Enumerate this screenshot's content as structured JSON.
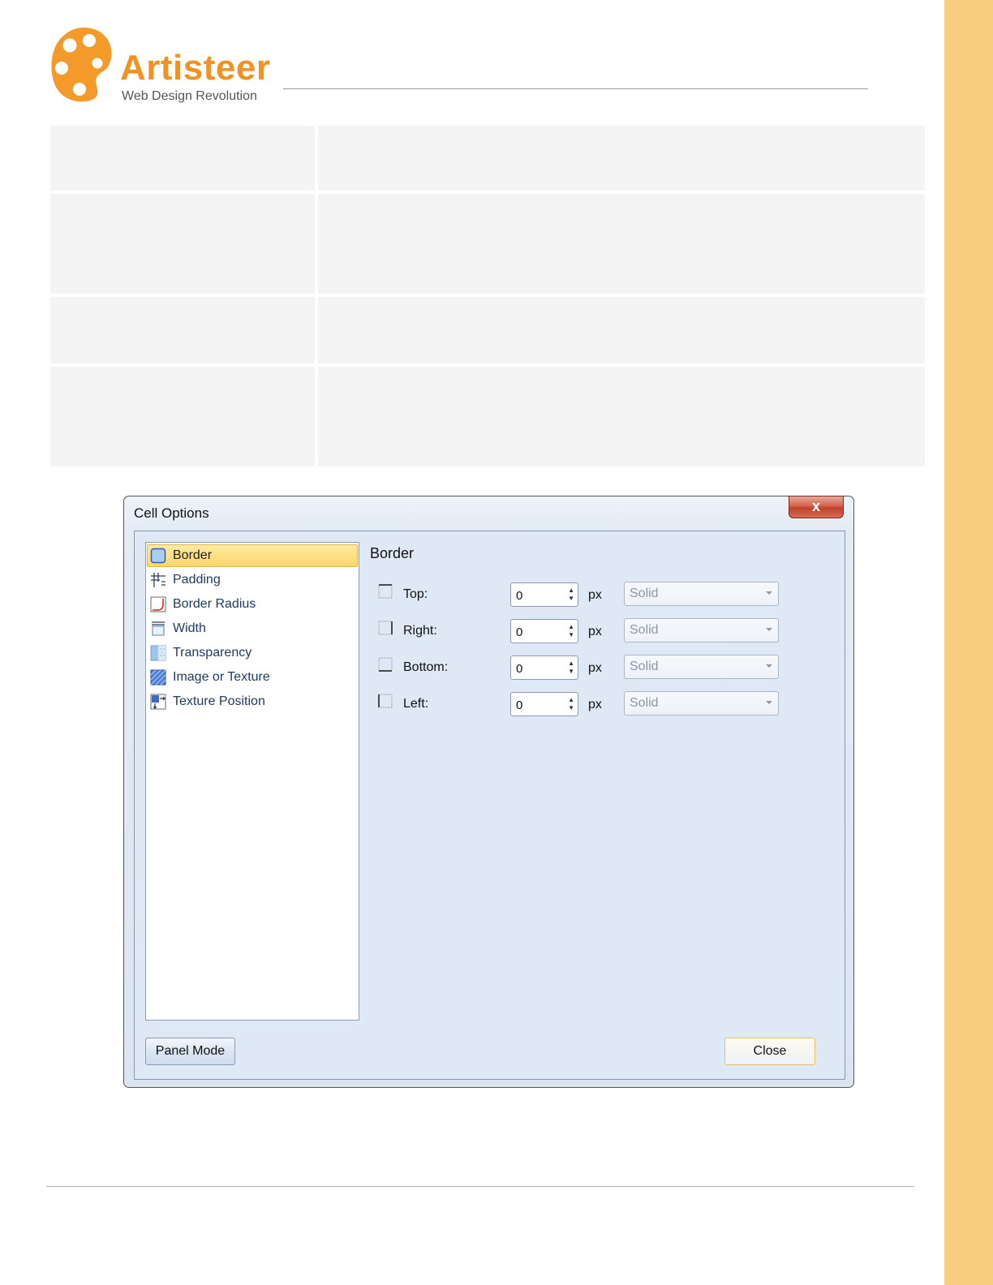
{
  "brand": {
    "name": "Artisteer",
    "tagline": "Web Design Revolution",
    "color": "#f29222"
  },
  "dialog": {
    "title": "Cell Options",
    "close_symbol": "x",
    "nav_items": [
      {
        "label": "Border",
        "icon": "border-icon",
        "selected": true
      },
      {
        "label": "Padding",
        "icon": "padding-icon",
        "selected": false
      },
      {
        "label": "Border Radius",
        "icon": "border-radius-icon",
        "selected": false
      },
      {
        "label": "Width",
        "icon": "width-icon",
        "selected": false
      },
      {
        "label": "Transparency",
        "icon": "transparency-icon",
        "selected": false
      },
      {
        "label": "Image or Texture",
        "icon": "image-texture-icon",
        "selected": false
      },
      {
        "label": "Texture Position",
        "icon": "texture-position-icon",
        "selected": false
      }
    ],
    "section_title": "Border",
    "fields": [
      {
        "label": "Top:",
        "value": "0",
        "unit": "px",
        "style": "Solid"
      },
      {
        "label": "Right:",
        "value": "0",
        "unit": "px",
        "style": "Solid"
      },
      {
        "label": "Bottom:",
        "value": "0",
        "unit": "px",
        "style": "Solid"
      },
      {
        "label": "Left:",
        "value": "0",
        "unit": "px",
        "style": "Solid"
      }
    ],
    "panel_mode_label": "Panel Mode",
    "close_label": "Close"
  }
}
